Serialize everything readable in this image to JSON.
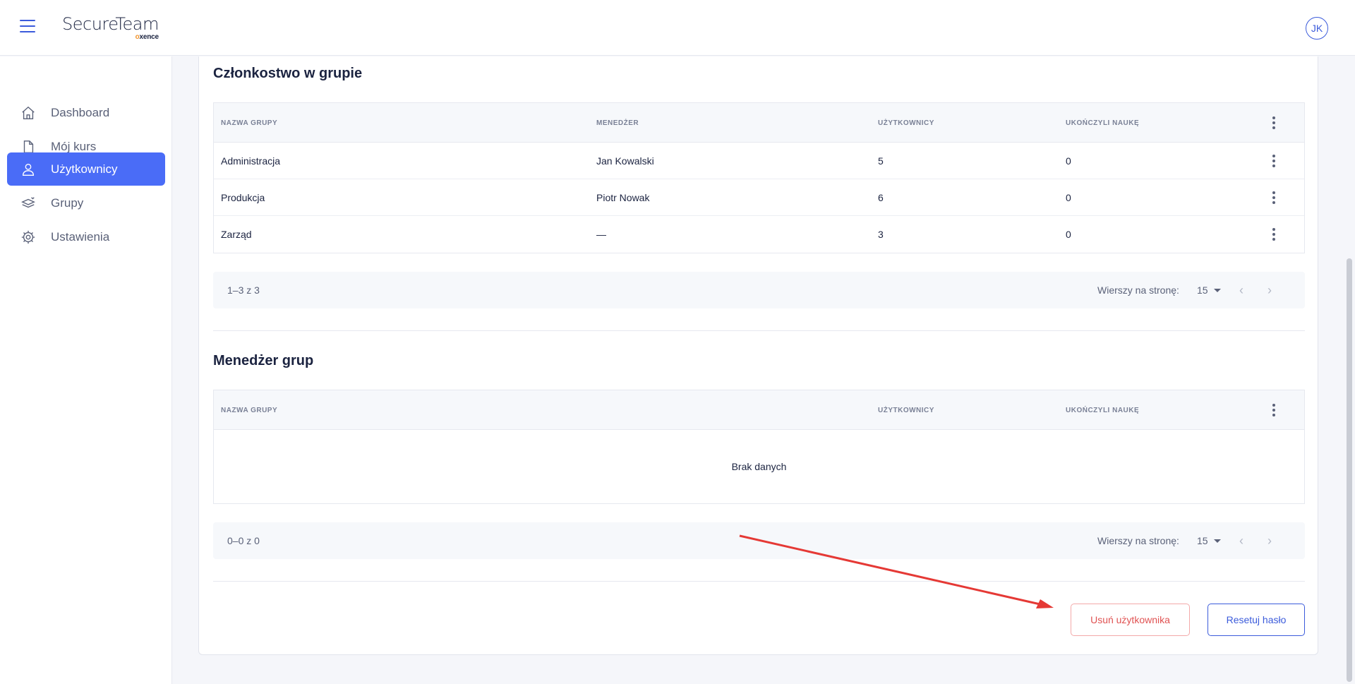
{
  "header": {
    "logo_main": "SecureTeam",
    "logo_sub_prefix": "o",
    "logo_sub_rest": "xence",
    "avatar_initials": "JK"
  },
  "sidebar": {
    "items": [
      {
        "label": "Dashboard",
        "icon": "home-icon",
        "active": false
      },
      {
        "label": "Mój kurs",
        "icon": "document-icon",
        "active": false
      },
      {
        "label": "Użytkownicy",
        "icon": "user-icon",
        "active": true
      },
      {
        "label": "Grupy",
        "icon": "layers-icon",
        "active": false
      },
      {
        "label": "Ustawienia",
        "icon": "gear-icon",
        "active": false
      }
    ]
  },
  "membership": {
    "title": "Członkostwo w grupie",
    "columns": [
      "NAZWA GRUPY",
      "MENEDŻER",
      "UŻYTKOWNICY",
      "UKOŃCZYLI NAUKĘ"
    ],
    "rows": [
      {
        "group": "Administracja",
        "manager": "Jan Kowalski",
        "users": "5",
        "completed": "0"
      },
      {
        "group": "Produkcja",
        "manager": "Piotr Nowak",
        "users": "6",
        "completed": "0"
      },
      {
        "group": "Zarząd",
        "manager": "—",
        "users": "3",
        "completed": "0"
      }
    ],
    "pager": {
      "range": "1–3 z 3",
      "rows_label": "Wierszy na stronę:",
      "rows_value": "15"
    }
  },
  "managers": {
    "title": "Menedżer grup",
    "columns": [
      "NAZWA GRUPY",
      "UŻYTKOWNICY",
      "UKOŃCZYLI NAUKĘ"
    ],
    "empty_text": "Brak danych",
    "pager": {
      "range": "0–0 z 0",
      "rows_label": "Wierszy na stronę:",
      "rows_value": "15"
    }
  },
  "actions": {
    "delete_label": "Usuń użytkownika",
    "reset_label": "Resetuj hasło"
  },
  "colors": {
    "accent": "#4a6cf7",
    "danger": "#e05252",
    "annotation_arrow": "#e53935"
  }
}
